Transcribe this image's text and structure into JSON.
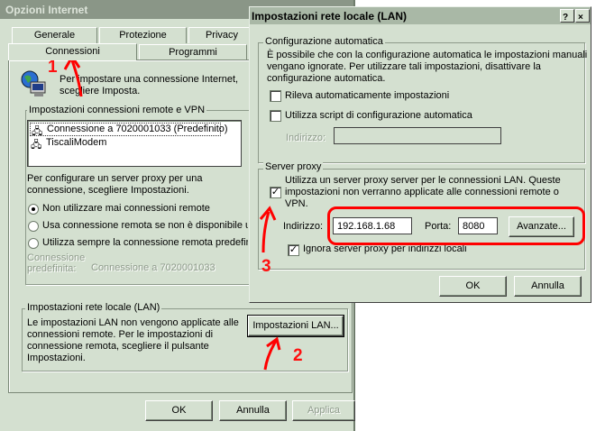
{
  "back_window": {
    "title": "Opzioni Internet",
    "tabs_row1": [
      "Generale",
      "Protezione",
      "Privacy"
    ],
    "tabs_row2": [
      "Connessioni",
      "Programmi"
    ],
    "intro_text_line1": "Per impostare una connessione Internet,",
    "intro_text_line2": "scegliere Imposta.",
    "dialup_group_label": "Impostazioni connessioni remote e VPN",
    "connections": [
      "Connessione a 7020001033 (Predefinito)",
      "TiscaliModem"
    ],
    "proxy_text_line1": "Per configurare un server proxy per una",
    "proxy_text_line2": "connessione, scegliere Impostazioni.",
    "radio_options": [
      "Non utilizzare mai connessioni remote",
      "Usa connessione remota se non è disponibile ur",
      "Utilizza sempre la connessione remota predefinit"
    ],
    "default_label_line1": "Connessione",
    "default_label_line2": "predefinita:",
    "default_value": "Connessione a 7020001033",
    "lan_group_label": "Impostazioni rete locale (LAN)",
    "lan_text_line1": "Le impostazioni LAN non vengono applicate alle",
    "lan_text_line2": "connessioni remote. Per le impostazioni di",
    "lan_text_line3": "connessione remota, scegliere il pulsante",
    "lan_text_line4": "Impostazioni.",
    "lan_button": "Impostazioni LAN...",
    "ok_button": "OK",
    "cancel_button": "Annulla",
    "apply_button": "Applica"
  },
  "front_dialog": {
    "title": "Impostazioni rete locale (LAN)",
    "help_glyph": "?",
    "close_glyph": "×",
    "auto_group_label": "Configurazione automatica",
    "auto_text_line1": "È possibile che con la configurazione automatica le impostazioni manuali",
    "auto_text_line2": "vengano ignorate. Per utilizzare tali impostazioni, disattivare la",
    "auto_text_line3": "configurazione automatica.",
    "detect_label": "Rileva automaticamente impostazioni",
    "script_label": "Utilizza script di configurazione automatica",
    "script_address_label": "Indirizzo:",
    "proxy_group_label": "Server proxy",
    "proxy_text_line1": "Utilizza un server proxy server per le connessioni LAN. Queste",
    "proxy_text_line2": "impostazioni non verranno applicate alle connessioni remote o",
    "proxy_text_line3": "VPN.",
    "address_label": "Indirizzo:",
    "address_value": "192.168.1.68",
    "port_label": "Porta:",
    "port_value": "8080",
    "advanced_button": "Avanzate...",
    "bypass_label": "Ignora server proxy per indirizzi locali",
    "ok_button": "OK",
    "cancel_button": "Annulla"
  },
  "annotations": {
    "step1": "1",
    "step2": "2",
    "step3": "3"
  },
  "colors": {
    "annotation": "#ff0000",
    "dialog_bg": "#d4e0d0"
  }
}
